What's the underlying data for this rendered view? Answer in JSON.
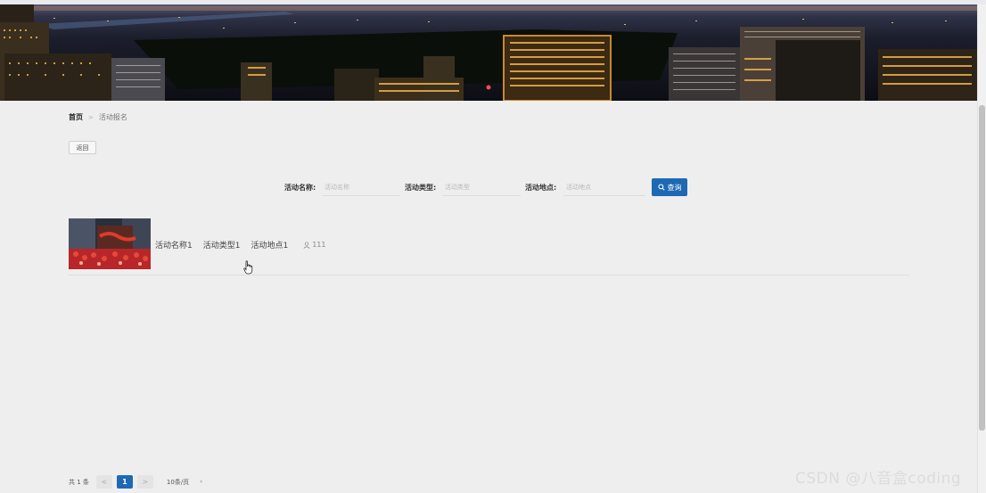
{
  "breadcrumb": {
    "home": "首页",
    "separator": ">",
    "current": "活动报名"
  },
  "back_button": {
    "label": "返回"
  },
  "search": {
    "fields": [
      {
        "label": "活动名称:",
        "placeholder": "活动名称"
      },
      {
        "label": "活动类型:",
        "placeholder": "活动类型"
      },
      {
        "label": "活动地点:",
        "placeholder": "活动地点"
      }
    ],
    "button_label": "查询",
    "button_icon": "search-icon"
  },
  "activities": [
    {
      "name": "活动名称1",
      "type": "活动类型1",
      "location": "活动地点1",
      "count": "111",
      "count_icon": "user-icon"
    }
  ],
  "pagination": {
    "total": "共 1 条",
    "prev": "<",
    "current_page": "1",
    "next": ">",
    "page_size": "10条/页",
    "page_size_icon": "chevron-down-icon"
  },
  "watermark": "CSDN @八音盒coding",
  "colors": {
    "primary": "#1e69b4",
    "page_background": "#eeeeef"
  }
}
